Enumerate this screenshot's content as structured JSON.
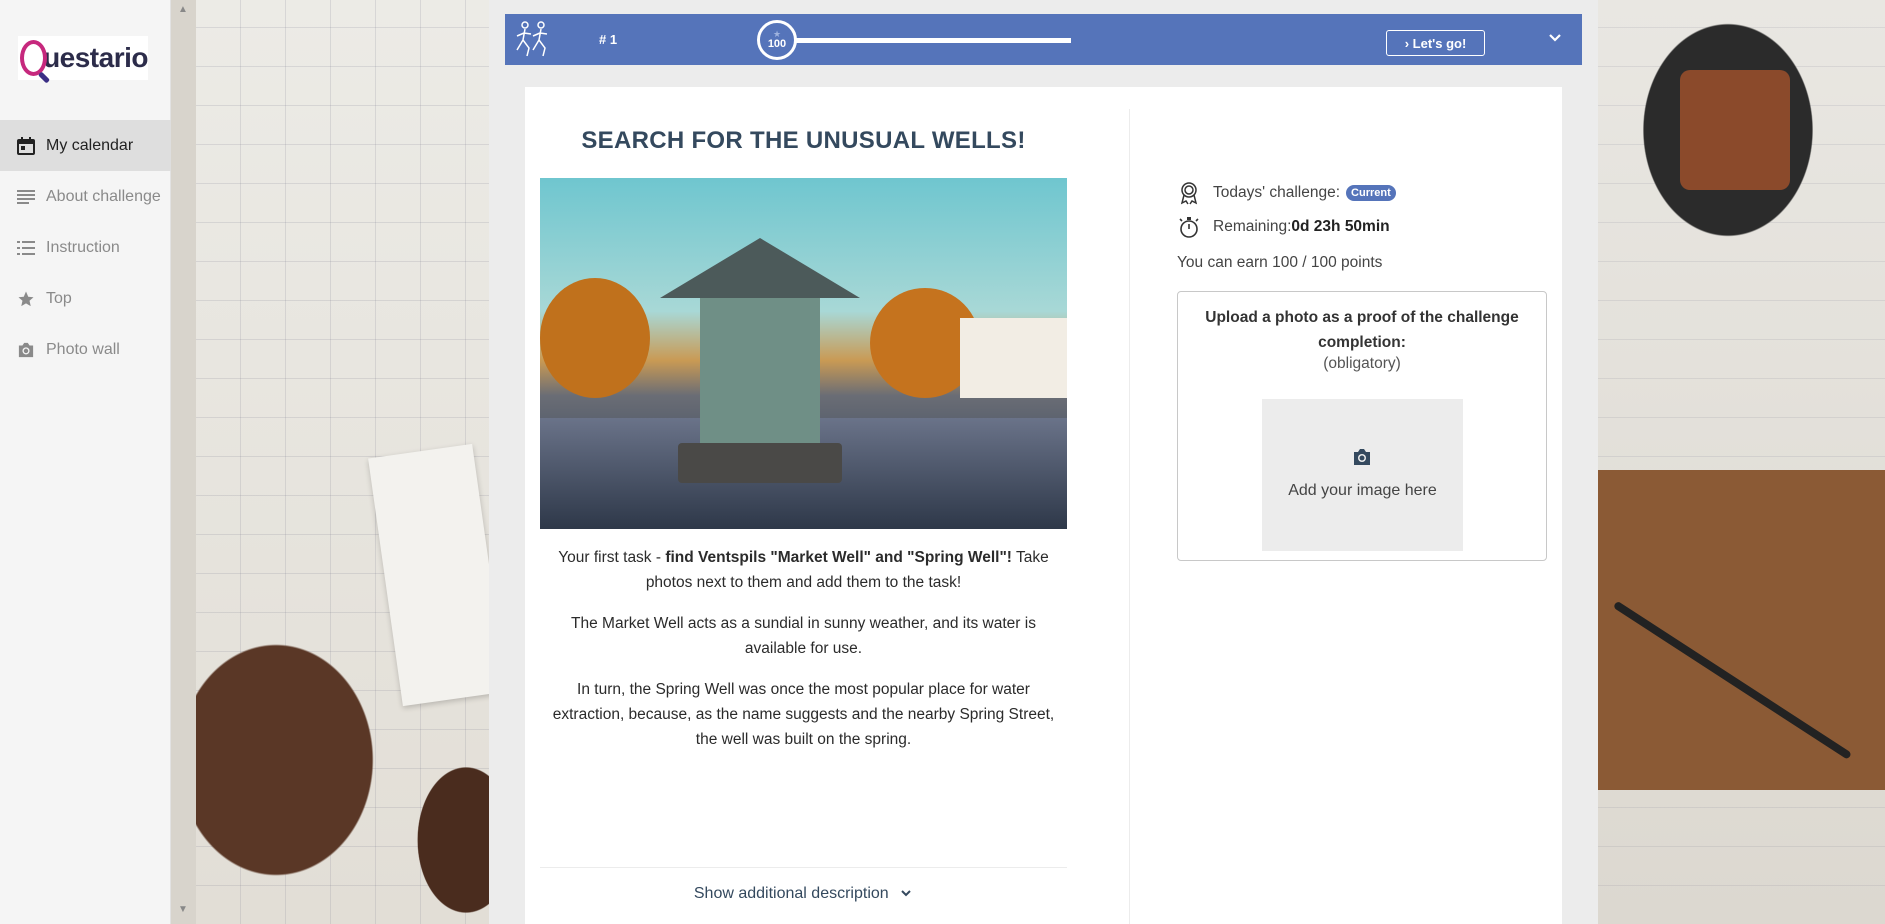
{
  "app": {
    "logo_text": "uestario"
  },
  "sidebar": {
    "items": [
      {
        "label": "My calendar",
        "icon": "calendar-icon"
      },
      {
        "label": "About challenge",
        "icon": "lines-icon"
      },
      {
        "label": "Instruction",
        "icon": "list-icon"
      },
      {
        "label": "Top",
        "icon": "star-icon"
      },
      {
        "label": "Photo wall",
        "icon": "camera-icon"
      }
    ]
  },
  "topbar": {
    "task_number": "# 1",
    "progress_value": "100",
    "progress_fraction": 1.0,
    "go_label": "› Let's go!",
    "accent": "#5574ba"
  },
  "challenge": {
    "title": "SEARCH FOR THE UNUSUAL WELLS!",
    "task_prefix": "Your first task - ",
    "task_bold": "find Ventspils \"Market Well\" and \"Spring Well\"!",
    "task_suffix": " Take photos next to them and add them to the task!",
    "para2": "The Market Well acts as a sundial in sunny weather, and its water is available for use.",
    "para3": "In turn, the Spring Well was once the most popular place for water extraction, because, as the name suggests and the nearby Spring Street, the well was built on the spring.",
    "show_more": "Show additional description"
  },
  "status": {
    "today_label": "Todays' challenge:",
    "today_badge": "Current",
    "remaining_label": "Remaining: ",
    "remaining_value": "0d 23h 50min",
    "earn_text": "You can earn 100 / 100 points"
  },
  "upload": {
    "title": "Upload a photo as a proof of the challenge completion:",
    "subtitle": "(obligatory)",
    "drop_text": "Add your image here"
  }
}
